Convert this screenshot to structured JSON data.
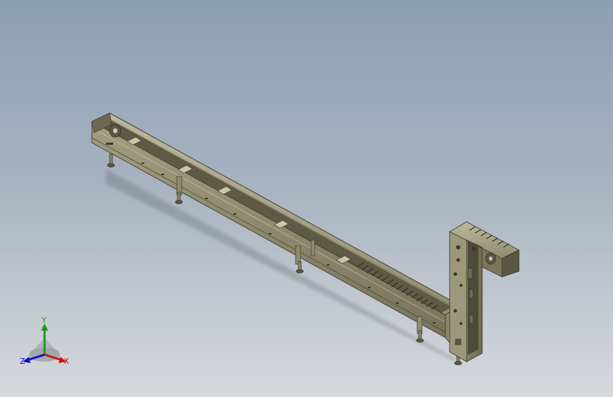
{
  "viewport": {
    "background_top": "#8d9fb4",
    "background_bottom": "#d6d8dc",
    "model_color": "#8a8668",
    "model_dark": "#4a4838",
    "model_light": "#b4b092"
  },
  "triad": {
    "y_label": "Y",
    "x_label": "X",
    "z_label": "Z",
    "y_color": "#1a9a1a",
    "x_color": "#d01010",
    "z_color": "#1010c8"
  }
}
